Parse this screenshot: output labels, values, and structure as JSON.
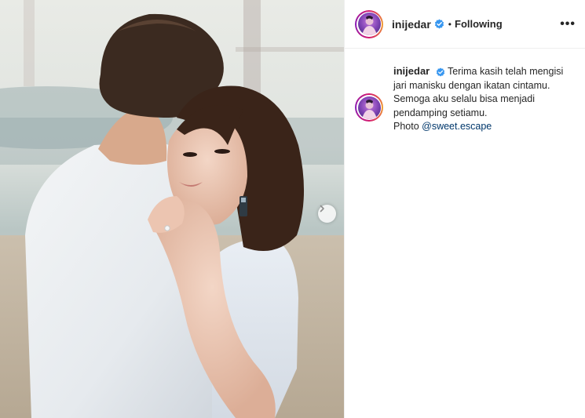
{
  "post": {
    "username": "inijedar",
    "follow_state": "Following",
    "separator": "•",
    "more_label": "•••"
  },
  "caption": {
    "username": "inijedar",
    "line1": "Terima kasih telah mengisi",
    "line2": "jari manisku dengan ikatan cintamu.",
    "line3": "Semoga aku selalu bisa menjadi",
    "line4": "pendamping setiamu.",
    "photo_prefix": "Photo ",
    "mention": "@sweet.escape"
  },
  "icons": {
    "verified": "verified-badge-icon",
    "next": "chevron-right-icon",
    "more": "more-options-icon"
  },
  "colors": {
    "verified_blue": "#3897f0",
    "link": "#00376b",
    "text": "#262626",
    "divider": "#efefef"
  }
}
